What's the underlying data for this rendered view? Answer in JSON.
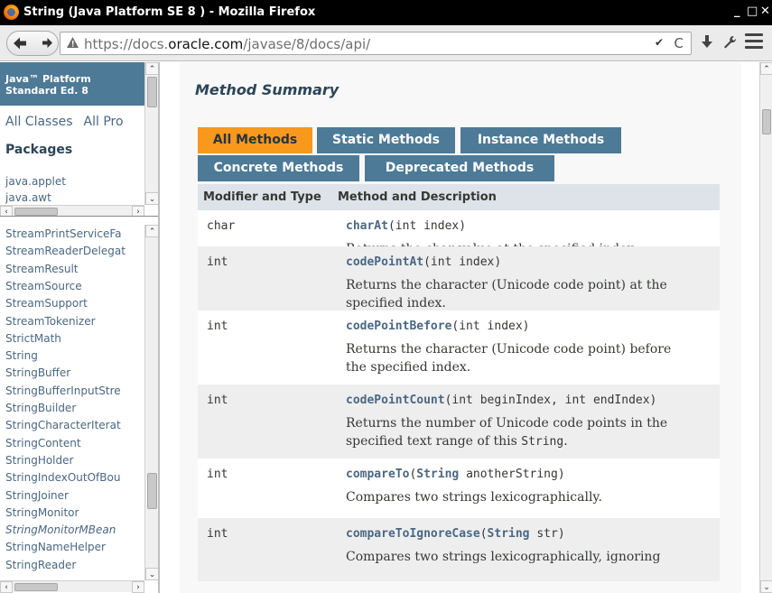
{
  "window": {
    "title": "String (Java Platform SE 8 ) - Mozilla Firefox",
    "controls": [
      "_",
      "□",
      "✕"
    ]
  },
  "navbar": {
    "back_icon": "◀",
    "forward_icon": "➔",
    "url_prefix": "https://docs.",
    "url_domain": "oracle.com",
    "url_suffix": "/javase/8/docs/api/",
    "dropdown_icon": "✔",
    "reload_icon": "C",
    "download_icon": "⬇",
    "tools_icon": "🔧"
  },
  "left": {
    "platform_line1": "Java™ Platform",
    "platform_line2": "Standard Ed. 8",
    "all_classes": "All Classes",
    "all_profiles": "All Pro",
    "packages_heading": "Packages",
    "packages": [
      "java.applet",
      "java.awt"
    ],
    "classes": [
      {
        "name": "StreamPrintServiceFa",
        "italic": false
      },
      {
        "name": "StreamReaderDelegat",
        "italic": false
      },
      {
        "name": "StreamResult",
        "italic": false
      },
      {
        "name": "StreamSource",
        "italic": false
      },
      {
        "name": "StreamSupport",
        "italic": false
      },
      {
        "name": "StreamTokenizer",
        "italic": false
      },
      {
        "name": "StrictMath",
        "italic": false
      },
      {
        "name": "String",
        "italic": false
      },
      {
        "name": "StringBuffer",
        "italic": false
      },
      {
        "name": "StringBufferInputStre",
        "italic": false
      },
      {
        "name": "StringBuilder",
        "italic": false
      },
      {
        "name": "StringCharacterIterat",
        "italic": false
      },
      {
        "name": "StringContent",
        "italic": false
      },
      {
        "name": "StringHolder",
        "italic": false
      },
      {
        "name": "StringIndexOutOfBou",
        "italic": false
      },
      {
        "name": "StringJoiner",
        "italic": false
      },
      {
        "name": "StringMonitor",
        "italic": false
      },
      {
        "name": "StringMonitorMBean",
        "italic": true
      },
      {
        "name": "StringNameHelper",
        "italic": false
      },
      {
        "name": "StringReader",
        "italic": false
      }
    ]
  },
  "main": {
    "heading": "Method Summary",
    "tabs_row1": [
      "All Methods",
      "Static Methods",
      "Instance Methods"
    ],
    "tabs_row2": [
      "Concrete Methods",
      "Deprecated Methods"
    ],
    "active_tab": "All Methods",
    "table_headers": [
      "Modifier and Type",
      "Method and Description"
    ],
    "rows": [
      {
        "type": "char",
        "name": "charAt",
        "params_pre": "(int index)",
        "typelink": "",
        "params_post": "",
        "desc": [
          "Returns the char value at the specified index."
        ]
      },
      {
        "type": "int",
        "name": "codePointAt",
        "params_pre": "(int index)",
        "typelink": "",
        "params_post": "",
        "desc": [
          "Returns the character (Unicode code point) at the",
          "specified index."
        ]
      },
      {
        "type": "int",
        "name": "codePointBefore",
        "params_pre": "(int index)",
        "typelink": "",
        "params_post": "",
        "desc": [
          "Returns the character (Unicode code point) before",
          "the specified index."
        ]
      },
      {
        "type": "int",
        "name": "codePointCount",
        "params_pre": "(int beginIndex, int endIndex)",
        "typelink": "",
        "params_post": "",
        "desc": [
          "Returns the number of Unicode code points in the",
          "specified text range of this String."
        ]
      },
      {
        "type": "int",
        "name": "compareTo",
        "params_pre": "(",
        "typelink": "String",
        "params_post": " anotherString)",
        "desc": [
          "Compares two strings lexicographically."
        ]
      },
      {
        "type": "int",
        "name": "compareToIgnoreCase",
        "params_pre": "(",
        "typelink": "String",
        "params_post": " str)",
        "desc": [
          "Compares two strings lexicographically, ignoring"
        ]
      }
    ]
  }
}
